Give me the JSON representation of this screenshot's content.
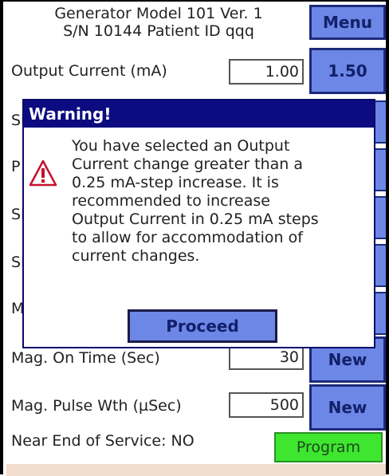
{
  "header": {
    "line1": "Generator Model 101 Ver. 1",
    "line2": "S/N 10144  Patient ID qqq"
  },
  "menu_button": "Menu",
  "output_current": {
    "label": "Output Current (mA)",
    "value": "1.00",
    "new_value_button": "1.50"
  },
  "hidden_row_fragments": [
    "Si",
    "P",
    "Si",
    "Si",
    "M"
  ],
  "mag_on_time": {
    "label": "Mag. On Time (Sec)",
    "value": "30",
    "button": "New"
  },
  "mag_pulse_width": {
    "label": "Mag. Pulse Wth (µSec)",
    "value": "500",
    "button": "New"
  },
  "near_end_of_service": "Near End of Service: NO",
  "program_button": "Program",
  "dialog": {
    "title": "Warning!",
    "message": "You have selected an Output\nCurrent change greater than a\n0.25 mA-step increase.  It is\nrecommended to increase\nOutput Current in 0.25 mA steps\nto allow for accommodation of\ncurrent changes.",
    "icon": "warning-triangle-icon",
    "proceed_button": "Proceed"
  },
  "colors": {
    "button_blue": "#6c87e6",
    "title_bar": "#0c0c80",
    "program_green": "#3ee62f"
  }
}
